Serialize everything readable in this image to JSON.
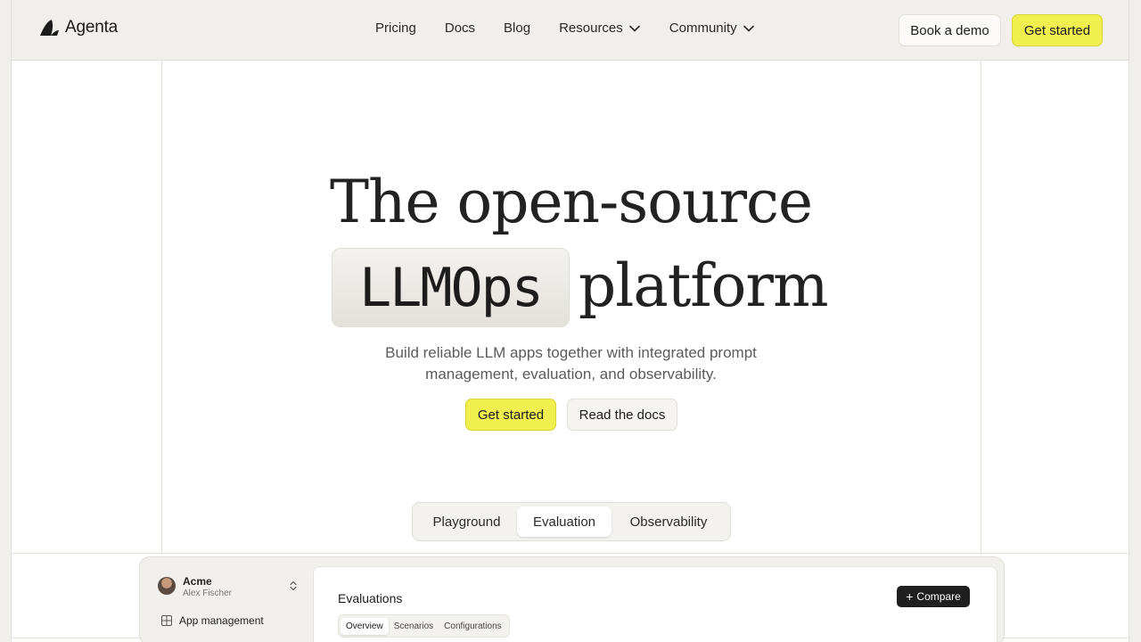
{
  "header": {
    "brand": "Agenta",
    "nav": [
      "Pricing",
      "Docs",
      "Blog",
      "Resources",
      "Community"
    ],
    "book_demo": "Book a demo",
    "get_started": "Get started"
  },
  "hero": {
    "line1": "The open-source",
    "highlight": "LLMOps",
    "line2_rest": "platform",
    "subtitle_1": "Build reliable LLM apps together with integrated prompt",
    "subtitle_2": "management, evaluation, and observability.",
    "cta_primary": "Get started",
    "cta_secondary": "Read the docs"
  },
  "tabs": {
    "items": [
      "Playground",
      "Evaluation",
      "Observability"
    ],
    "active": "Evaluation"
  },
  "preview": {
    "org": "Acme",
    "user": "Alex Fischer",
    "side_item": "App management",
    "panel_title": "Evaluations",
    "compare": "Compare",
    "tabs": [
      "Overview",
      "Scenarios",
      "Configurations"
    ]
  },
  "colors": {
    "accent_yellow": "#f1ee50",
    "background": "#f1efeb",
    "dark": "#1f1f1f"
  }
}
